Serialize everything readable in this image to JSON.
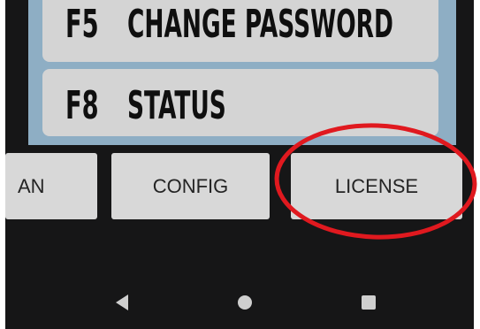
{
  "menu": {
    "items": [
      {
        "key": "F5",
        "label": "CHANGE PASSWORD"
      },
      {
        "key": "F8",
        "label": "STATUS"
      }
    ]
  },
  "tabs": {
    "scan_label": "AN",
    "config_label": "CONFIG",
    "license_label": "LICENSE"
  },
  "nav": {
    "back": "back-icon",
    "home": "home-icon",
    "recents": "recents-icon"
  },
  "colors": {
    "screen_background": "#161617",
    "menu_panel": "#8eaec4",
    "menu_item": "#d4d4d4",
    "tab_button": "#d8d8d8",
    "highlight": "#e0191f"
  }
}
